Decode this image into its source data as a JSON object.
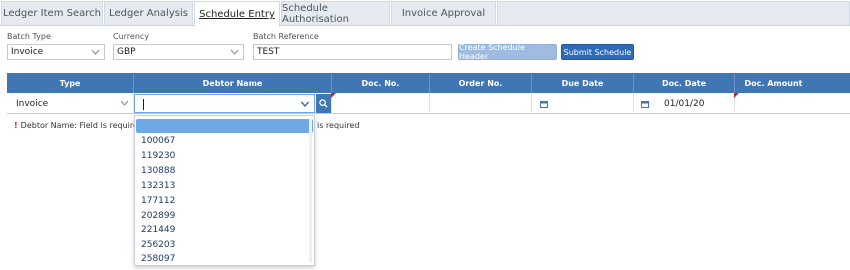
{
  "tabs": [
    {
      "label": "Ledger Item Search",
      "active": false
    },
    {
      "label": "Ledger Analysis",
      "active": false
    },
    {
      "label": "Schedule Entry",
      "active": true
    },
    {
      "label": "Schedule Authorisation",
      "active": false
    },
    {
      "label": "Invoice Approval",
      "active": false
    }
  ],
  "header": {
    "batch_type_label": "Batch Type",
    "batch_type_value": "Invoice",
    "currency_label": "Currency",
    "currency_value": "GBP",
    "batch_ref_label": "Batch Reference",
    "batch_ref_value": "TEST",
    "create_button": "Create Schedule Header",
    "submit_button": "Submit Schedule"
  },
  "grid": {
    "columns": [
      "Type",
      "Debtor Name",
      "Doc. No.",
      "Order No.",
      "Due Date",
      "Doc. Date",
      "Doc. Amount"
    ],
    "row": {
      "type": "Invoice",
      "debtor_name": "",
      "doc_no": "",
      "order_no": "",
      "due_date": "",
      "doc_date": "01/01/20",
      "doc_amount": ""
    }
  },
  "errors": {
    "debtor": "Debtor Name: Field is required",
    "second": "is required"
  },
  "dropdown": {
    "options": [
      "",
      "100067",
      "119230",
      "130888",
      "132313",
      "177112",
      "202899",
      "221449",
      "256203",
      "258097"
    ]
  },
  "icons": {
    "chevron": "chevron-down-icon",
    "search": "search-icon",
    "calendar": "calendar-icon"
  },
  "colors": {
    "header_blue": "#3f76b3",
    "primary_button": "#2e6ab8",
    "highlight": "#6fa8e6",
    "error_red": "#d02020"
  }
}
